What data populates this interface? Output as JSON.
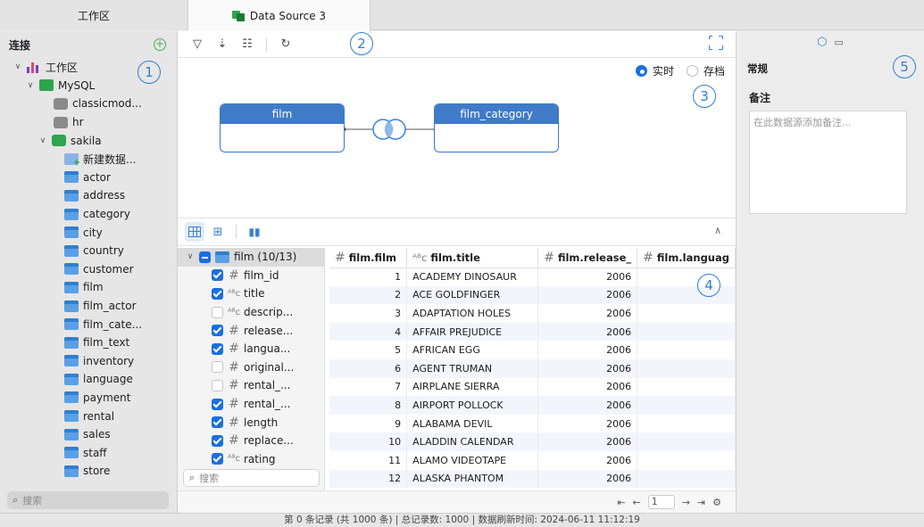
{
  "tabs": {
    "workspace": "工作区",
    "datasource": "Data Source 3"
  },
  "sidebar": {
    "title": "连接",
    "add_icon": "add-connection-icon",
    "workspace_label": "工作区",
    "mysql_label": "MySQL",
    "databases": [
      "classicmod...",
      "hr"
    ],
    "sakila_label": "sakila",
    "new_datasource": "新建数据...",
    "tables": [
      "actor",
      "address",
      "category",
      "city",
      "country",
      "customer",
      "film",
      "film_actor",
      "film_cate...",
      "film_text",
      "inventory",
      "language",
      "payment",
      "rental",
      "sales",
      "staff",
      "store"
    ],
    "search_placeholder": "搜索"
  },
  "canvas": {
    "mode_realtime": "实时",
    "mode_archive": "存档",
    "left_table": "film",
    "right_table": "film_category"
  },
  "fields": {
    "root_label": "film (10/13)",
    "items": [
      {
        "name": "film_id",
        "type": "#",
        "checked": true
      },
      {
        "name": "title",
        "type": "ABC",
        "checked": true
      },
      {
        "name": "descrip...",
        "type": "ABC",
        "checked": false
      },
      {
        "name": "release...",
        "type": "#",
        "checked": true
      },
      {
        "name": "langua...",
        "type": "#",
        "checked": true
      },
      {
        "name": "original...",
        "type": "#",
        "checked": false
      },
      {
        "name": "rental_...",
        "type": "#",
        "checked": false
      },
      {
        "name": "rental_...",
        "type": "#",
        "checked": true
      },
      {
        "name": "length",
        "type": "#",
        "checked": true
      },
      {
        "name": "replace...",
        "type": "#",
        "checked": true
      },
      {
        "name": "rating",
        "type": "ABC",
        "checked": true
      }
    ],
    "search_placeholder": "搜索"
  },
  "grid": {
    "columns": [
      {
        "label": "film.film",
        "type": "#"
      },
      {
        "label": "film.title",
        "type": "ABC"
      },
      {
        "label": "film.release_",
        "type": "#"
      },
      {
        "label": "film.languag",
        "type": "#"
      }
    ],
    "rows": [
      [
        "1",
        "ACADEMY DINOSAUR",
        "2006",
        ""
      ],
      [
        "2",
        "ACE GOLDFINGER",
        "2006",
        ""
      ],
      [
        "3",
        "ADAPTATION HOLES",
        "2006",
        ""
      ],
      [
        "4",
        "AFFAIR PREJUDICE",
        "2006",
        ""
      ],
      [
        "5",
        "AFRICAN EGG",
        "2006",
        ""
      ],
      [
        "6",
        "AGENT TRUMAN",
        "2006",
        ""
      ],
      [
        "7",
        "AIRPLANE SIERRA",
        "2006",
        ""
      ],
      [
        "8",
        "AIRPORT POLLOCK",
        "2006",
        ""
      ],
      [
        "9",
        "ALABAMA DEVIL",
        "2006",
        ""
      ],
      [
        "10",
        "ALADDIN CALENDAR",
        "2006",
        ""
      ],
      [
        "11",
        "ALAMO VIDEOTAPE",
        "2006",
        ""
      ],
      [
        "12",
        "ALASKA PHANTOM",
        "2006",
        ""
      ]
    ]
  },
  "pager": {
    "page": "1"
  },
  "right_panel": {
    "section": "常规",
    "notes_label": "备注",
    "notes_placeholder": "在此数据源添加备注..."
  },
  "status": "第 0 条记录 (共 1000 条)  |  总记录数: 1000  |  数据刷新时间: 2024-06-11 11:12:19",
  "callouts": [
    "1",
    "2",
    "3",
    "4",
    "5"
  ],
  "colors": {
    "accent": "#1a6fe0",
    "table_header": "#3f7bc7",
    "callout": "#2f7fd0"
  }
}
